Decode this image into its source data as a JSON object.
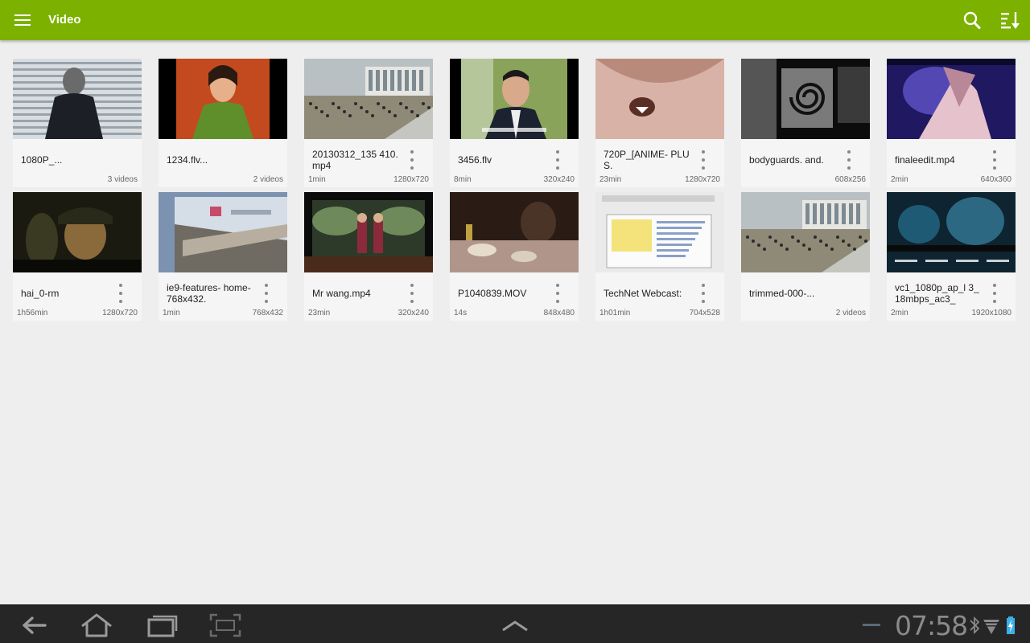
{
  "app": {
    "title": "Video"
  },
  "colors": {
    "accent": "#7cb100",
    "nav_bg": "#262626",
    "status_icon": "#8a8a8a",
    "battery": "#3bb0e8"
  },
  "toolbar": {
    "menu_icon": "menu-icon",
    "search_icon": "search-icon",
    "sort_icon": "sort-icon"
  },
  "videos": [
    {
      "name": "1080P_...",
      "duration": "",
      "resolution": "3 videos",
      "scene": "man-window"
    },
    {
      "name": "1234.flv...",
      "duration": "",
      "resolution": "2 videos",
      "scene": "singer"
    },
    {
      "name": "20130312_135 410.mp4",
      "duration": "1min",
      "resolution": "1280x720",
      "scene": "crowd-building"
    },
    {
      "name": "3456.flv",
      "duration": "8min",
      "resolution": "320x240",
      "scene": "news-man"
    },
    {
      "name": "720P_[ANIME- PLUS.",
      "duration": "23min",
      "resolution": "1280x720",
      "scene": "anime"
    },
    {
      "name": "bodyguards. and.",
      "duration": "",
      "resolution": "608x256",
      "scene": "spiral"
    },
    {
      "name": "finaleedit.mp4",
      "duration": "2min",
      "resolution": "640x360",
      "scene": "stage"
    },
    {
      "name": "hai_0-rm",
      "duration": "1h56min",
      "resolution": "1280x720",
      "scene": "soldier"
    },
    {
      "name": "ie9-features- home-768x432.",
      "duration": "1min",
      "resolution": "768x432",
      "scene": "browser"
    },
    {
      "name": "Mr wang.mp4",
      "duration": "23min",
      "resolution": "320x240",
      "scene": "theater"
    },
    {
      "name": "P1040839.MOV",
      "duration": "14s",
      "resolution": "848x480",
      "scene": "dinner"
    },
    {
      "name": "TechNet Webcast:",
      "duration": "1h01min",
      "resolution": "704x528",
      "scene": "screencast"
    },
    {
      "name": "trimmed-000-...",
      "duration": "",
      "resolution": "2 videos",
      "scene": "crowd-building"
    },
    {
      "name": "vc1_1080p_ap_l 3_18mbps_ac3_",
      "duration": "2min",
      "resolution": "1920x1080",
      "scene": "movie-menu"
    }
  ],
  "status": {
    "time": "07:58"
  },
  "nav": {
    "back": "back-icon",
    "home": "home-icon",
    "recents": "recent-apps-icon",
    "screenshot": "screenshot-icon",
    "up": "chevron-up-icon"
  }
}
